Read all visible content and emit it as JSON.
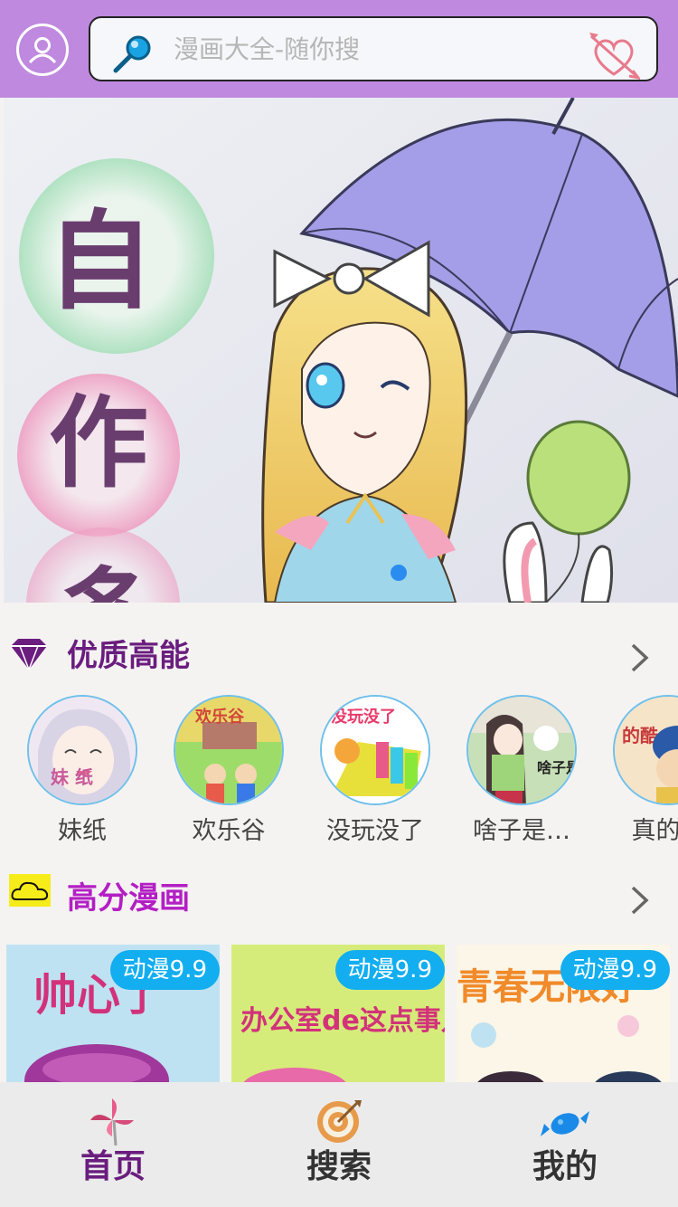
{
  "header": {
    "search_placeholder": "漫画大全-随你搜"
  },
  "banner": {
    "text_chars": [
      "自",
      "作",
      "多"
    ]
  },
  "sections": {
    "featured": {
      "title": "优质高能"
    },
    "top_rated": {
      "title": "高分漫画"
    }
  },
  "categories": [
    {
      "label": "妹纸",
      "image_text": "妹 纸"
    },
    {
      "label": "欢乐谷",
      "image_text": "欢乐谷"
    },
    {
      "label": "没玩没了",
      "image_text": "没玩没了"
    },
    {
      "label": "啥子是…",
      "image_text": "啥子是"
    },
    {
      "label": "真的酷",
      "image_text": "的酷"
    }
  ],
  "comics": [
    {
      "badge": "动漫9.9",
      "cover_text": "帅心了"
    },
    {
      "badge": "动漫9.9",
      "cover_text": "办公室de这点事儿"
    },
    {
      "badge": "动漫9.9",
      "cover_text": "青春无限好"
    }
  ],
  "nav": {
    "home": "首页",
    "search": "搜索",
    "mine": "我的"
  },
  "colors": {
    "header_bg": "#bf89df",
    "accent_purple": "#7a1f8c",
    "badge_blue": "#12aef0",
    "dot_blue": "#2b8cf0"
  }
}
